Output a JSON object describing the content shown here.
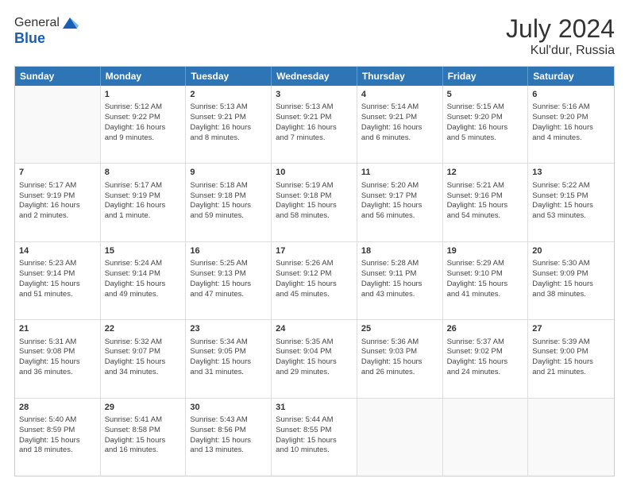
{
  "header": {
    "logo_general": "General",
    "logo_blue": "Blue",
    "month_year": "July 2024",
    "location": "Kul'dur, Russia"
  },
  "weekdays": [
    "Sunday",
    "Monday",
    "Tuesday",
    "Wednesday",
    "Thursday",
    "Friday",
    "Saturday"
  ],
  "rows": [
    [
      {
        "day": "",
        "info": ""
      },
      {
        "day": "1",
        "info": "Sunrise: 5:12 AM\nSunset: 9:22 PM\nDaylight: 16 hours\nand 9 minutes."
      },
      {
        "day": "2",
        "info": "Sunrise: 5:13 AM\nSunset: 9:21 PM\nDaylight: 16 hours\nand 8 minutes."
      },
      {
        "day": "3",
        "info": "Sunrise: 5:13 AM\nSunset: 9:21 PM\nDaylight: 16 hours\nand 7 minutes."
      },
      {
        "day": "4",
        "info": "Sunrise: 5:14 AM\nSunset: 9:21 PM\nDaylight: 16 hours\nand 6 minutes."
      },
      {
        "day": "5",
        "info": "Sunrise: 5:15 AM\nSunset: 9:20 PM\nDaylight: 16 hours\nand 5 minutes."
      },
      {
        "day": "6",
        "info": "Sunrise: 5:16 AM\nSunset: 9:20 PM\nDaylight: 16 hours\nand 4 minutes."
      }
    ],
    [
      {
        "day": "7",
        "info": "Sunrise: 5:17 AM\nSunset: 9:19 PM\nDaylight: 16 hours\nand 2 minutes."
      },
      {
        "day": "8",
        "info": "Sunrise: 5:17 AM\nSunset: 9:19 PM\nDaylight: 16 hours\nand 1 minute."
      },
      {
        "day": "9",
        "info": "Sunrise: 5:18 AM\nSunset: 9:18 PM\nDaylight: 15 hours\nand 59 minutes."
      },
      {
        "day": "10",
        "info": "Sunrise: 5:19 AM\nSunset: 9:18 PM\nDaylight: 15 hours\nand 58 minutes."
      },
      {
        "day": "11",
        "info": "Sunrise: 5:20 AM\nSunset: 9:17 PM\nDaylight: 15 hours\nand 56 minutes."
      },
      {
        "day": "12",
        "info": "Sunrise: 5:21 AM\nSunset: 9:16 PM\nDaylight: 15 hours\nand 54 minutes."
      },
      {
        "day": "13",
        "info": "Sunrise: 5:22 AM\nSunset: 9:15 PM\nDaylight: 15 hours\nand 53 minutes."
      }
    ],
    [
      {
        "day": "14",
        "info": "Sunrise: 5:23 AM\nSunset: 9:14 PM\nDaylight: 15 hours\nand 51 minutes."
      },
      {
        "day": "15",
        "info": "Sunrise: 5:24 AM\nSunset: 9:14 PM\nDaylight: 15 hours\nand 49 minutes."
      },
      {
        "day": "16",
        "info": "Sunrise: 5:25 AM\nSunset: 9:13 PM\nDaylight: 15 hours\nand 47 minutes."
      },
      {
        "day": "17",
        "info": "Sunrise: 5:26 AM\nSunset: 9:12 PM\nDaylight: 15 hours\nand 45 minutes."
      },
      {
        "day": "18",
        "info": "Sunrise: 5:28 AM\nSunset: 9:11 PM\nDaylight: 15 hours\nand 43 minutes."
      },
      {
        "day": "19",
        "info": "Sunrise: 5:29 AM\nSunset: 9:10 PM\nDaylight: 15 hours\nand 41 minutes."
      },
      {
        "day": "20",
        "info": "Sunrise: 5:30 AM\nSunset: 9:09 PM\nDaylight: 15 hours\nand 38 minutes."
      }
    ],
    [
      {
        "day": "21",
        "info": "Sunrise: 5:31 AM\nSunset: 9:08 PM\nDaylight: 15 hours\nand 36 minutes."
      },
      {
        "day": "22",
        "info": "Sunrise: 5:32 AM\nSunset: 9:07 PM\nDaylight: 15 hours\nand 34 minutes."
      },
      {
        "day": "23",
        "info": "Sunrise: 5:34 AM\nSunset: 9:05 PM\nDaylight: 15 hours\nand 31 minutes."
      },
      {
        "day": "24",
        "info": "Sunrise: 5:35 AM\nSunset: 9:04 PM\nDaylight: 15 hours\nand 29 minutes."
      },
      {
        "day": "25",
        "info": "Sunrise: 5:36 AM\nSunset: 9:03 PM\nDaylight: 15 hours\nand 26 minutes."
      },
      {
        "day": "26",
        "info": "Sunrise: 5:37 AM\nSunset: 9:02 PM\nDaylight: 15 hours\nand 24 minutes."
      },
      {
        "day": "27",
        "info": "Sunrise: 5:39 AM\nSunset: 9:00 PM\nDaylight: 15 hours\nand 21 minutes."
      }
    ],
    [
      {
        "day": "28",
        "info": "Sunrise: 5:40 AM\nSunset: 8:59 PM\nDaylight: 15 hours\nand 18 minutes."
      },
      {
        "day": "29",
        "info": "Sunrise: 5:41 AM\nSunset: 8:58 PM\nDaylight: 15 hours\nand 16 minutes."
      },
      {
        "day": "30",
        "info": "Sunrise: 5:43 AM\nSunset: 8:56 PM\nDaylight: 15 hours\nand 13 minutes."
      },
      {
        "day": "31",
        "info": "Sunrise: 5:44 AM\nSunset: 8:55 PM\nDaylight: 15 hours\nand 10 minutes."
      },
      {
        "day": "",
        "info": ""
      },
      {
        "day": "",
        "info": ""
      },
      {
        "day": "",
        "info": ""
      }
    ]
  ]
}
